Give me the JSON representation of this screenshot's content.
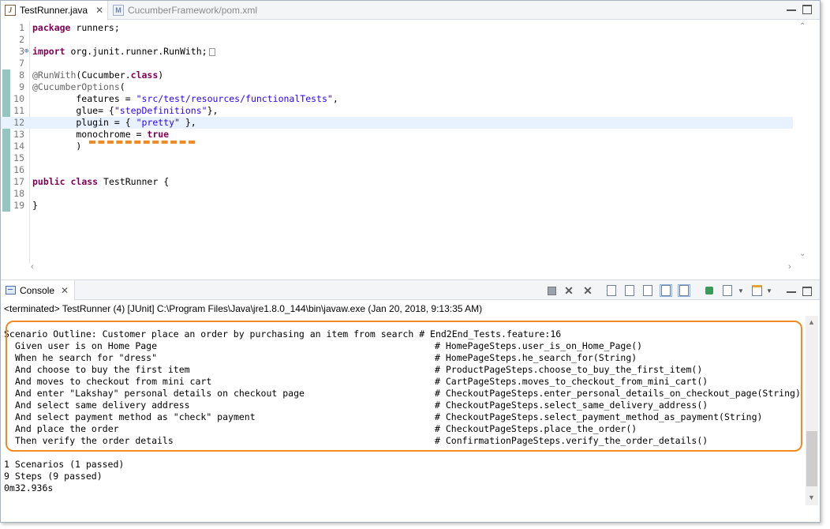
{
  "editor_tabs": [
    {
      "label": "TestRunner.java",
      "icon": "java-file-icon",
      "active": true
    },
    {
      "label": "CucumberFramework/pom.xml",
      "icon": "xml-file-icon",
      "active": false
    }
  ],
  "code_lines": [
    {
      "n": "1",
      "html": "<span class=\"kw\">package</span> runners;"
    },
    {
      "n": "2",
      "html": ""
    },
    {
      "n": "3",
      "html": "<span class=\"kw\">import</span> org.junit.runner.RunWith;<span class=\"fold-box\"></span>",
      "fold": true
    },
    {
      "n": "7",
      "html": ""
    },
    {
      "n": "8",
      "html": "<span class=\"ann\">@RunWith</span>(Cucumber.<span class=\"kw\">class</span>)"
    },
    {
      "n": "9",
      "html": "<span class=\"ann\">@CucumberOptions</span>("
    },
    {
      "n": "10",
      "html": "        features = <span class=\"str\">\"src/test/resources/functionalTests\"</span>,"
    },
    {
      "n": "11",
      "html": "        glue= {<span class=\"str\">\"stepDefinitions\"</span>},"
    },
    {
      "n": "12",
      "html": "        plugin = { <span class=\"str\">\"pretty\"</span> },",
      "current": true
    },
    {
      "n": "13",
      "html": "        monochrome = <span class=\"kw\">true</span>"
    },
    {
      "n": "14",
      "html": "        )"
    },
    {
      "n": "15",
      "html": ""
    },
    {
      "n": "16",
      "html": ""
    },
    {
      "n": "17",
      "html": "<span class=\"kw\">public</span> <span class=\"kw\">class</span> TestRunner {"
    },
    {
      "n": "18",
      "html": ""
    },
    {
      "n": "19",
      "html": "}"
    }
  ],
  "console": {
    "tab_label": "Console",
    "terminated_text": "<terminated> TestRunner (4) [JUnit] C:\\Program Files\\Java\\jre1.8.0_144\\bin\\javaw.exe (Jan 20, 2018, 9:13:35 AM)",
    "scenario_line": "Scenario Outline: Customer place an order by purchasing an item from search # End2End_Tests.feature:16",
    "steps": [
      {
        "text": "Given user is on Home Page",
        "glue": "# HomePageSteps.user_is_on_Home_Page()"
      },
      {
        "text": "When he search for \"dress\"",
        "glue": "# HomePageSteps.he_search_for(String)"
      },
      {
        "text": "And choose to buy the first item",
        "glue": "# ProductPageSteps.choose_to_buy_the_first_item()"
      },
      {
        "text": "And moves to checkout from mini cart",
        "glue": "# CartPageSteps.moves_to_checkout_from_mini_cart()"
      },
      {
        "text": "And enter \"Lakshay\" personal details on checkout page",
        "glue": "# CheckoutPageSteps.enter_personal_details_on_checkout_page(String)"
      },
      {
        "text": "And select same delivery address",
        "glue": "# CheckoutPageSteps.select_same_delivery_address()"
      },
      {
        "text": "And select payment method as \"check\" payment",
        "glue": "# CheckoutPageSteps.select_payment_method_as_payment(String)"
      },
      {
        "text": "And place the order",
        "glue": "# CheckoutPageSteps.place_the_order()"
      },
      {
        "text": "Then verify the order details",
        "glue": "# ConfirmationPageSteps.verify_the_order_details()"
      }
    ],
    "summary": [
      "1 Scenarios (1 passed)",
      "9 Steps (9 passed)",
      "0m32.936s"
    ]
  },
  "colors": {
    "highlight": "#f08a24",
    "keyword": "#7f0055",
    "string": "#2a00ff",
    "annotation": "#646464"
  }
}
